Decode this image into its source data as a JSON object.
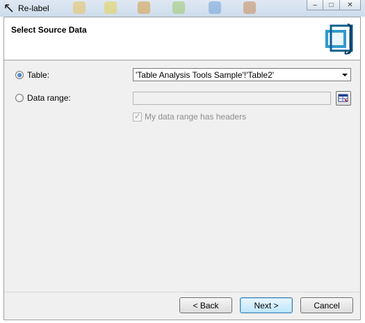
{
  "window": {
    "title": "Re-label"
  },
  "header": {
    "title": "Select Source Data",
    "graphic_icon": "table-range-illustration-icon"
  },
  "source": {
    "table_label": "Table:",
    "table_selected": true,
    "table_value": "'Table Analysis Tools Sample'!'Table2'",
    "data_range_label": "Data range:",
    "data_range_selected": false,
    "data_range_value": "",
    "headers_checkbox_label": "My data range has headers",
    "headers_checked": true,
    "headers_enabled": false
  },
  "buttons": {
    "back": "< Back",
    "next": "Next >",
    "cancel": "Cancel"
  },
  "colors": {
    "accent": "#1a8fc9",
    "default_button_border": "#3c7fb1"
  }
}
